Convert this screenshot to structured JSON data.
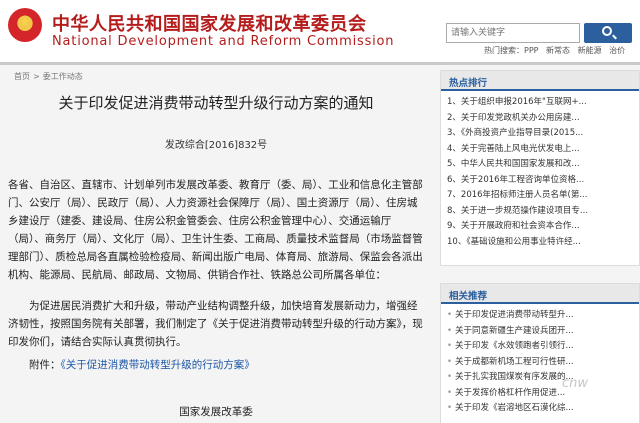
{
  "header": {
    "title_cn": "中华人民共和国国家发展和改革委员会",
    "title_en": "National Development and Reform Commission",
    "search_placeholder": "请输入关键字",
    "hot_search_label": "热门搜索：PPP",
    "hot_search_items": [
      "新常态",
      "新能源",
      "治价"
    ]
  },
  "breadcrumb": {
    "home": "首页",
    "sep": ">",
    "section": "委工作动态"
  },
  "article": {
    "title": "关于印发促进消费带动转型升级行动方案的通知",
    "doc_number": "发改综合[2016]832号",
    "para1": "各省、自治区、直辖市、计划单列市发展改革委、教育厅（委、局）、工业和信息化主管部门、公安厅（局）、民政厅（局）、人力资源社会保障厅（局）、国土资源厅（局）、住房城乡建设厅（建委、建设局、住房公积金管委会、住房公积金管理中心）、交通运输厅（局）、商务厅（局）、文化厅（局）、卫生计生委、工商局、质量技术监督局（市场监督管理部门）、质检总局各直属检验检疫局、新闻出版广电局、体育局、旅游局、保监会各派出机构、能源局、民航局、邮政局、文物局、供销合作社、铁路总公司所属各单位：",
    "para2": "为促进居民消费扩大和升级，带动产业结构调整升级，加快培育发展新动力，增强经济韧性，按照国务院有关部署，我们制定了《关于促进消费带动转型升级的行动方案》，现印发你们，请结合实际认真贯彻执行。",
    "attachment_label": "附件：",
    "attachment_link": "《关于促进消费带动转型升级的行动方案》",
    "org": "国家发展改革委"
  },
  "sidebar": {
    "hot_title": "热点排行",
    "hot_items": [
      "1、关于组织申报2016年\"互联网+...",
      "2、关于印发党政机关办公用房建...",
      "3、《外商投资产业指导目录(2015...",
      "4、关于完善陆上风电光伏发电上...",
      "5、中华人民共和国国家发展和改...",
      "6、关于2016年工程咨询单位资格...",
      "7、2016年招标师注册人员名单(第...",
      "8、关于进一步规范操作建设项目专...",
      "9、关于开展政府和社会资本合作...",
      "10、《基础设施和公用事业特许经..."
    ],
    "related_title": "相关推荐",
    "related_items": [
      "关于印发促进消费带动转型升...",
      "关于同意新疆生产建设兵团开...",
      "关于印发《水效领跑者引领行...",
      "关于成都新机场工程可行性研...",
      "关于扎实我国煤炭有序发展的...",
      "关于发挥价格杠杆作用促进...",
      "关于印发《岩溶地区石漠化综..."
    ]
  },
  "watermark": "cnw"
}
